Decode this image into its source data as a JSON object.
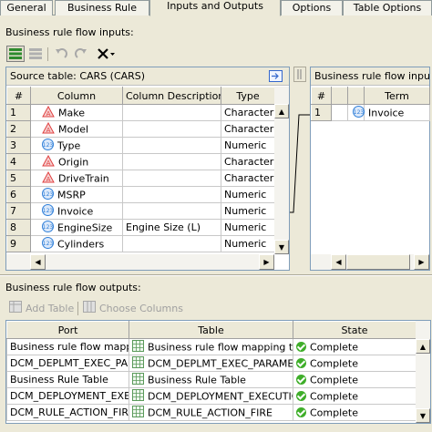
{
  "tabs": [
    "General",
    "Business Rule",
    "Inputs and Outputs",
    "Options",
    "Table Options"
  ],
  "inputs": {
    "section_label": "Business rule flow inputs:",
    "source_table_label": "Source table: CARS (CARS)",
    "columns_headers": [
      "#",
      "Column",
      "Column Description",
      "Type"
    ],
    "rows": [
      {
        "num": "1",
        "icon": "character-column-icon",
        "column": "Make",
        "description": "",
        "type": "Character"
      },
      {
        "num": "2",
        "icon": "character-column-icon",
        "column": "Model",
        "description": "",
        "type": "Character"
      },
      {
        "num": "3",
        "icon": "numeric-column-icon",
        "column": "Type",
        "description": "",
        "type": "Numeric"
      },
      {
        "num": "4",
        "icon": "character-column-icon",
        "column": "Origin",
        "description": "",
        "type": "Character"
      },
      {
        "num": "5",
        "icon": "character-column-icon",
        "column": "DriveTrain",
        "description": "",
        "type": "Character"
      },
      {
        "num": "6",
        "icon": "numeric-column-icon",
        "column": "MSRP",
        "description": "",
        "type": "Numeric"
      },
      {
        "num": "7",
        "icon": "numeric-column-icon",
        "column": "Invoice",
        "description": "",
        "type": "Numeric"
      },
      {
        "num": "8",
        "icon": "numeric-column-icon",
        "column": "EngineSize",
        "description": "Engine Size (L)",
        "type": "Numeric"
      },
      {
        "num": "9",
        "icon": "numeric-column-icon",
        "column": "Cylinders",
        "description": "",
        "type": "Numeric"
      }
    ],
    "target_panel_label": "Business rule flow input...",
    "target_headers": [
      "#",
      "",
      "",
      "Term"
    ],
    "target_rows": [
      {
        "num": "1",
        "icon": "numeric-column-icon",
        "term": "Invoice"
      }
    ]
  },
  "outputs": {
    "section_label": "Business rule flow outputs:",
    "add_table_label": "Add Table",
    "choose_columns_label": "Choose Columns",
    "headers": [
      "Port",
      "Table",
      "State"
    ],
    "rows": [
      {
        "port": "Business rule flow mappi...",
        "table": "Business rule flow mapping table",
        "state": "Complete"
      },
      {
        "port": "DCM_DEPLMT_EXEC_PA...",
        "table": "DCM_DEPLMT_EXEC_PARAME...",
        "state": "Complete"
      },
      {
        "port": "Business Rule Table",
        "table": "Business Rule Table",
        "state": "Complete"
      },
      {
        "port": "DCM_DEPLOYMENT_EXE...",
        "table": "DCM_DEPLOYMENT_EXECUTION",
        "state": "Complete"
      },
      {
        "port": "DCM_RULE_ACTION_FIRE",
        "table": "DCM_RULE_ACTION_FIRE",
        "state": "Complete"
      }
    ]
  },
  "colors": {
    "background": "#ece9d8",
    "character_icon": "#e04040",
    "numeric_icon": "#2f7fd8",
    "complete_status": "#3fae2a"
  }
}
